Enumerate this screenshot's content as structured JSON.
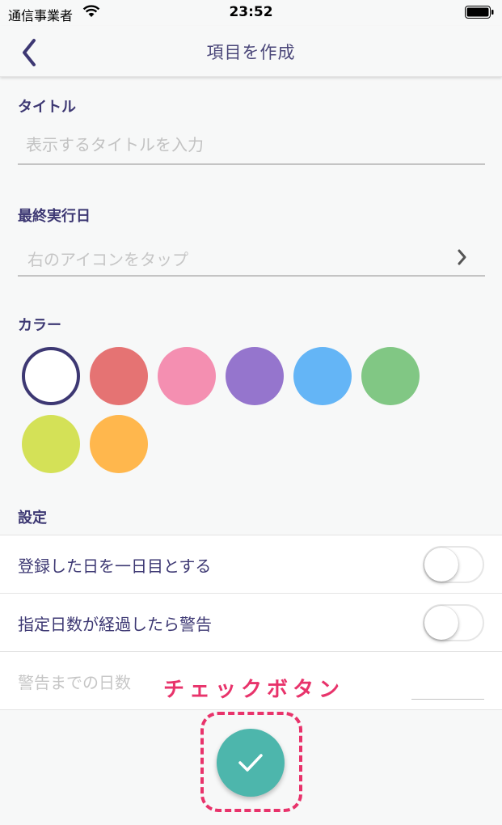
{
  "status_bar": {
    "carrier": "通信事業者",
    "time": "23:52"
  },
  "nav": {
    "title": "項目を作成",
    "back_icon": "chevron-left-icon"
  },
  "form": {
    "title_label": "タイトル",
    "title_placeholder": "表示するタイトルを入力",
    "title_value": "",
    "last_run_label": "最終実行日",
    "last_run_placeholder": "右のアイコンをタップ",
    "color_label": "カラー",
    "colors": [
      {
        "name": "white",
        "hex": "#ffffff",
        "selected": true
      },
      {
        "name": "red",
        "hex": "#e57373",
        "selected": false
      },
      {
        "name": "pink",
        "hex": "#f48fb1",
        "selected": false
      },
      {
        "name": "purple",
        "hex": "#9575cd",
        "selected": false
      },
      {
        "name": "blue",
        "hex": "#64b5f6",
        "selected": false
      },
      {
        "name": "green",
        "hex": "#81c784",
        "selected": false
      },
      {
        "name": "lime",
        "hex": "#d4e157",
        "selected": false
      },
      {
        "name": "orange",
        "hex": "#ffb74d",
        "selected": false
      }
    ],
    "settings_label": "設定"
  },
  "settings": {
    "count_first_day_label": "登録した日を一日目とする",
    "count_first_day_on": false,
    "warn_label": "指定日数が経過したら警告",
    "warn_on": false,
    "warn_days_label": "警告までの日数",
    "warn_days_value": ""
  },
  "annotation": {
    "label": "チェックボタン"
  },
  "accent": {
    "primary": "#3d3873",
    "fab": "#4db6ac",
    "annotation": "#e8336b"
  }
}
